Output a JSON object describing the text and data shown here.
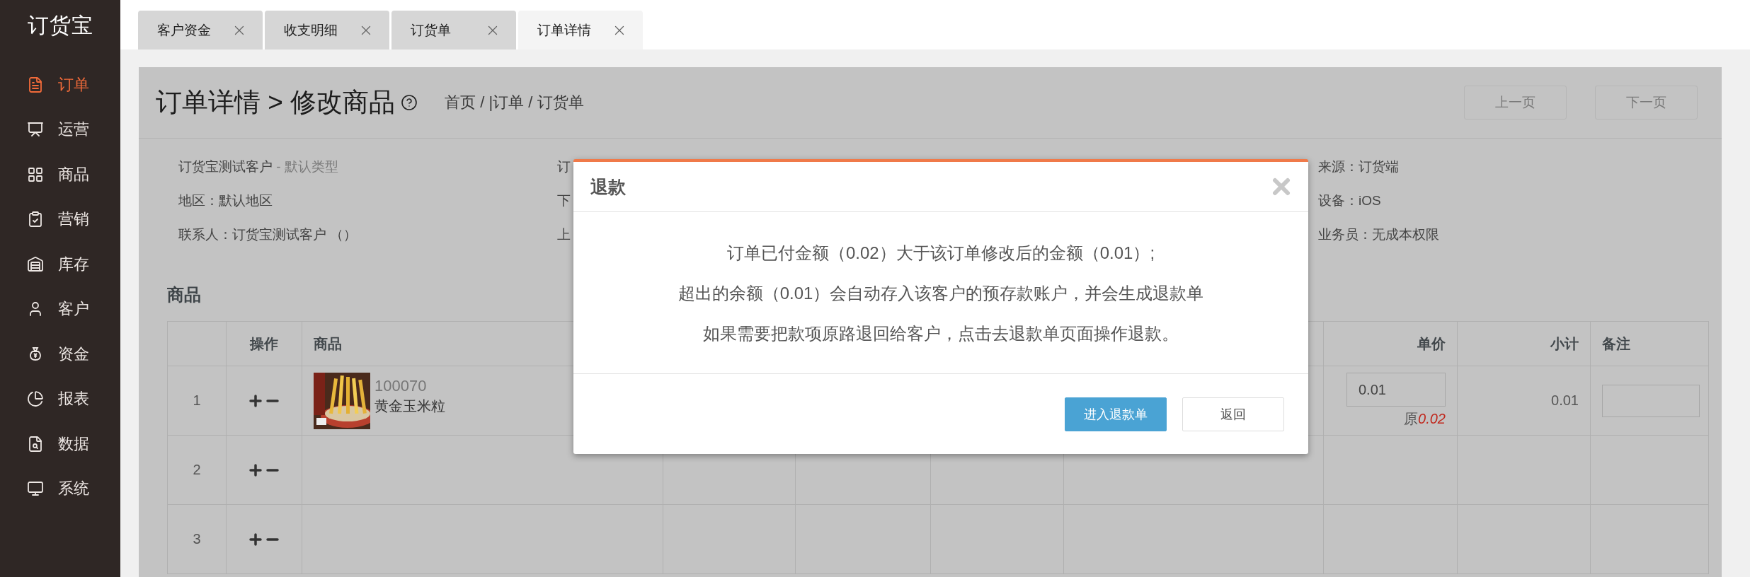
{
  "sidebar": {
    "logo": "订货宝",
    "items": [
      {
        "label": "订单",
        "selected": true
      },
      {
        "label": "运营",
        "selected": false
      },
      {
        "label": "商品",
        "selected": false
      },
      {
        "label": "营销",
        "selected": false
      },
      {
        "label": "库存",
        "selected": false
      },
      {
        "label": "客户",
        "selected": false
      },
      {
        "label": "资金",
        "selected": false
      },
      {
        "label": "报表",
        "selected": false
      },
      {
        "label": "数据",
        "selected": false
      },
      {
        "label": "系统",
        "selected": false
      }
    ]
  },
  "tabs": [
    {
      "label": "客户资金",
      "selected": false
    },
    {
      "label": "收支明细",
      "selected": false
    },
    {
      "label": "订货单",
      "selected": false
    },
    {
      "label": "订单详情",
      "selected": true
    }
  ],
  "header": {
    "title": "订单详情 > 修改商品",
    "breadcrumb": "首页 / |订单 / 订货单",
    "buttons": [
      "上一页",
      "下一页"
    ]
  },
  "info": {
    "column_1": [
      {
        "label": "订货宝测试客户",
        "note": "- 默认类型"
      },
      {
        "label": "地区：默认地区"
      },
      {
        "label": "联系人：订货宝测试客户 （）"
      }
    ],
    "column_2": [
      {
        "label": "订"
      },
      {
        "label": "下"
      },
      {
        "label": "上"
      }
    ],
    "column_3": [
      {
        "label": "来源：订货端"
      },
      {
        "label": "设备：iOS"
      },
      {
        "label": "业务员：无成本权限"
      }
    ]
  },
  "section_title": "商品",
  "table": {
    "columns": [
      {},
      {
        "label": "操作"
      },
      {
        "label": "商品"
      },
      {},
      {},
      {},
      {},
      {
        "label": "单价"
      },
      {
        "label": "小计"
      },
      {
        "label": "备注"
      }
    ],
    "rows": [
      {
        "number": "1",
        "product": {
          "code": "100070",
          "name": "黄金玉米粒"
        },
        "price": {
          "value": "0.01",
          "original_label": "原",
          "original": "0.02"
        },
        "subtotal": "0.01"
      },
      {
        "number": "2"
      },
      {
        "number": "3"
      }
    ]
  },
  "dialog": {
    "title": "退款",
    "lines": [
      "订单已付金额（0.02）大于该订单修改后的金额（0.01）;",
      "超出的余额（0.01）会自动存入该客户的预存款账户，并会生成退款单",
      "如果需要把款项原路退回给客户，点击去退款单页面操作退款。"
    ],
    "buttons": [
      {
        "label": "进入退款单",
        "kind": "primary"
      },
      {
        "label": "返回",
        "kind": "default"
      }
    ]
  }
}
